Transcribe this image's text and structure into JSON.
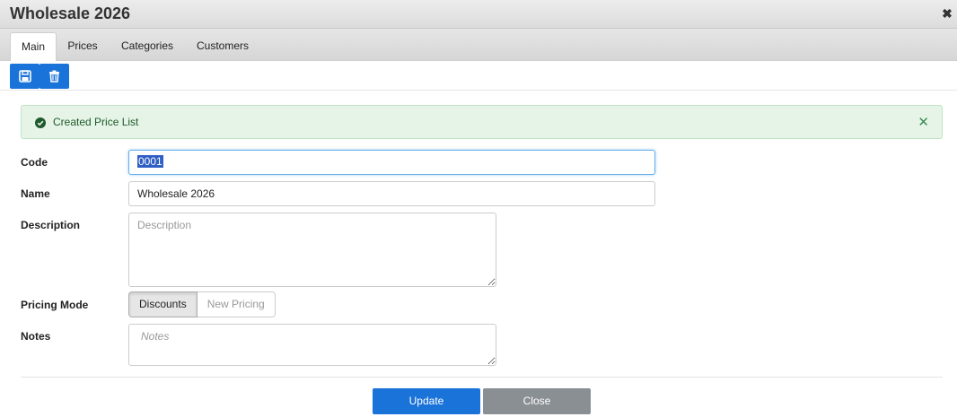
{
  "window": {
    "title": "Wholesale 2026",
    "close_glyph": "✖"
  },
  "tabs": [
    {
      "label": "Main",
      "active": true
    },
    {
      "label": "Prices",
      "active": false
    },
    {
      "label": "Categories",
      "active": false
    },
    {
      "label": "Customers",
      "active": false
    }
  ],
  "toolbar": {
    "save_icon": "save-icon",
    "delete_icon": "trash-icon",
    "accent": "#1a73d9"
  },
  "alert": {
    "text": "Created Price List",
    "close_glyph": "✕",
    "color": "#e5f4e7"
  },
  "form": {
    "code": {
      "label": "Code",
      "value": "0001"
    },
    "name": {
      "label": "Name",
      "value": "Wholesale 2026"
    },
    "description": {
      "label": "Description",
      "placeholder": "Description",
      "value": ""
    },
    "pricing_mode": {
      "label": "Pricing Mode",
      "options": [
        "Discounts",
        "New Pricing"
      ],
      "selected": "Discounts"
    },
    "notes": {
      "label": "Notes",
      "placeholder": "Notes",
      "value": ""
    }
  },
  "footer": {
    "update_label": "Update",
    "close_label": "Close",
    "update_color": "#1a73d9",
    "close_color": "#8a8f94"
  }
}
